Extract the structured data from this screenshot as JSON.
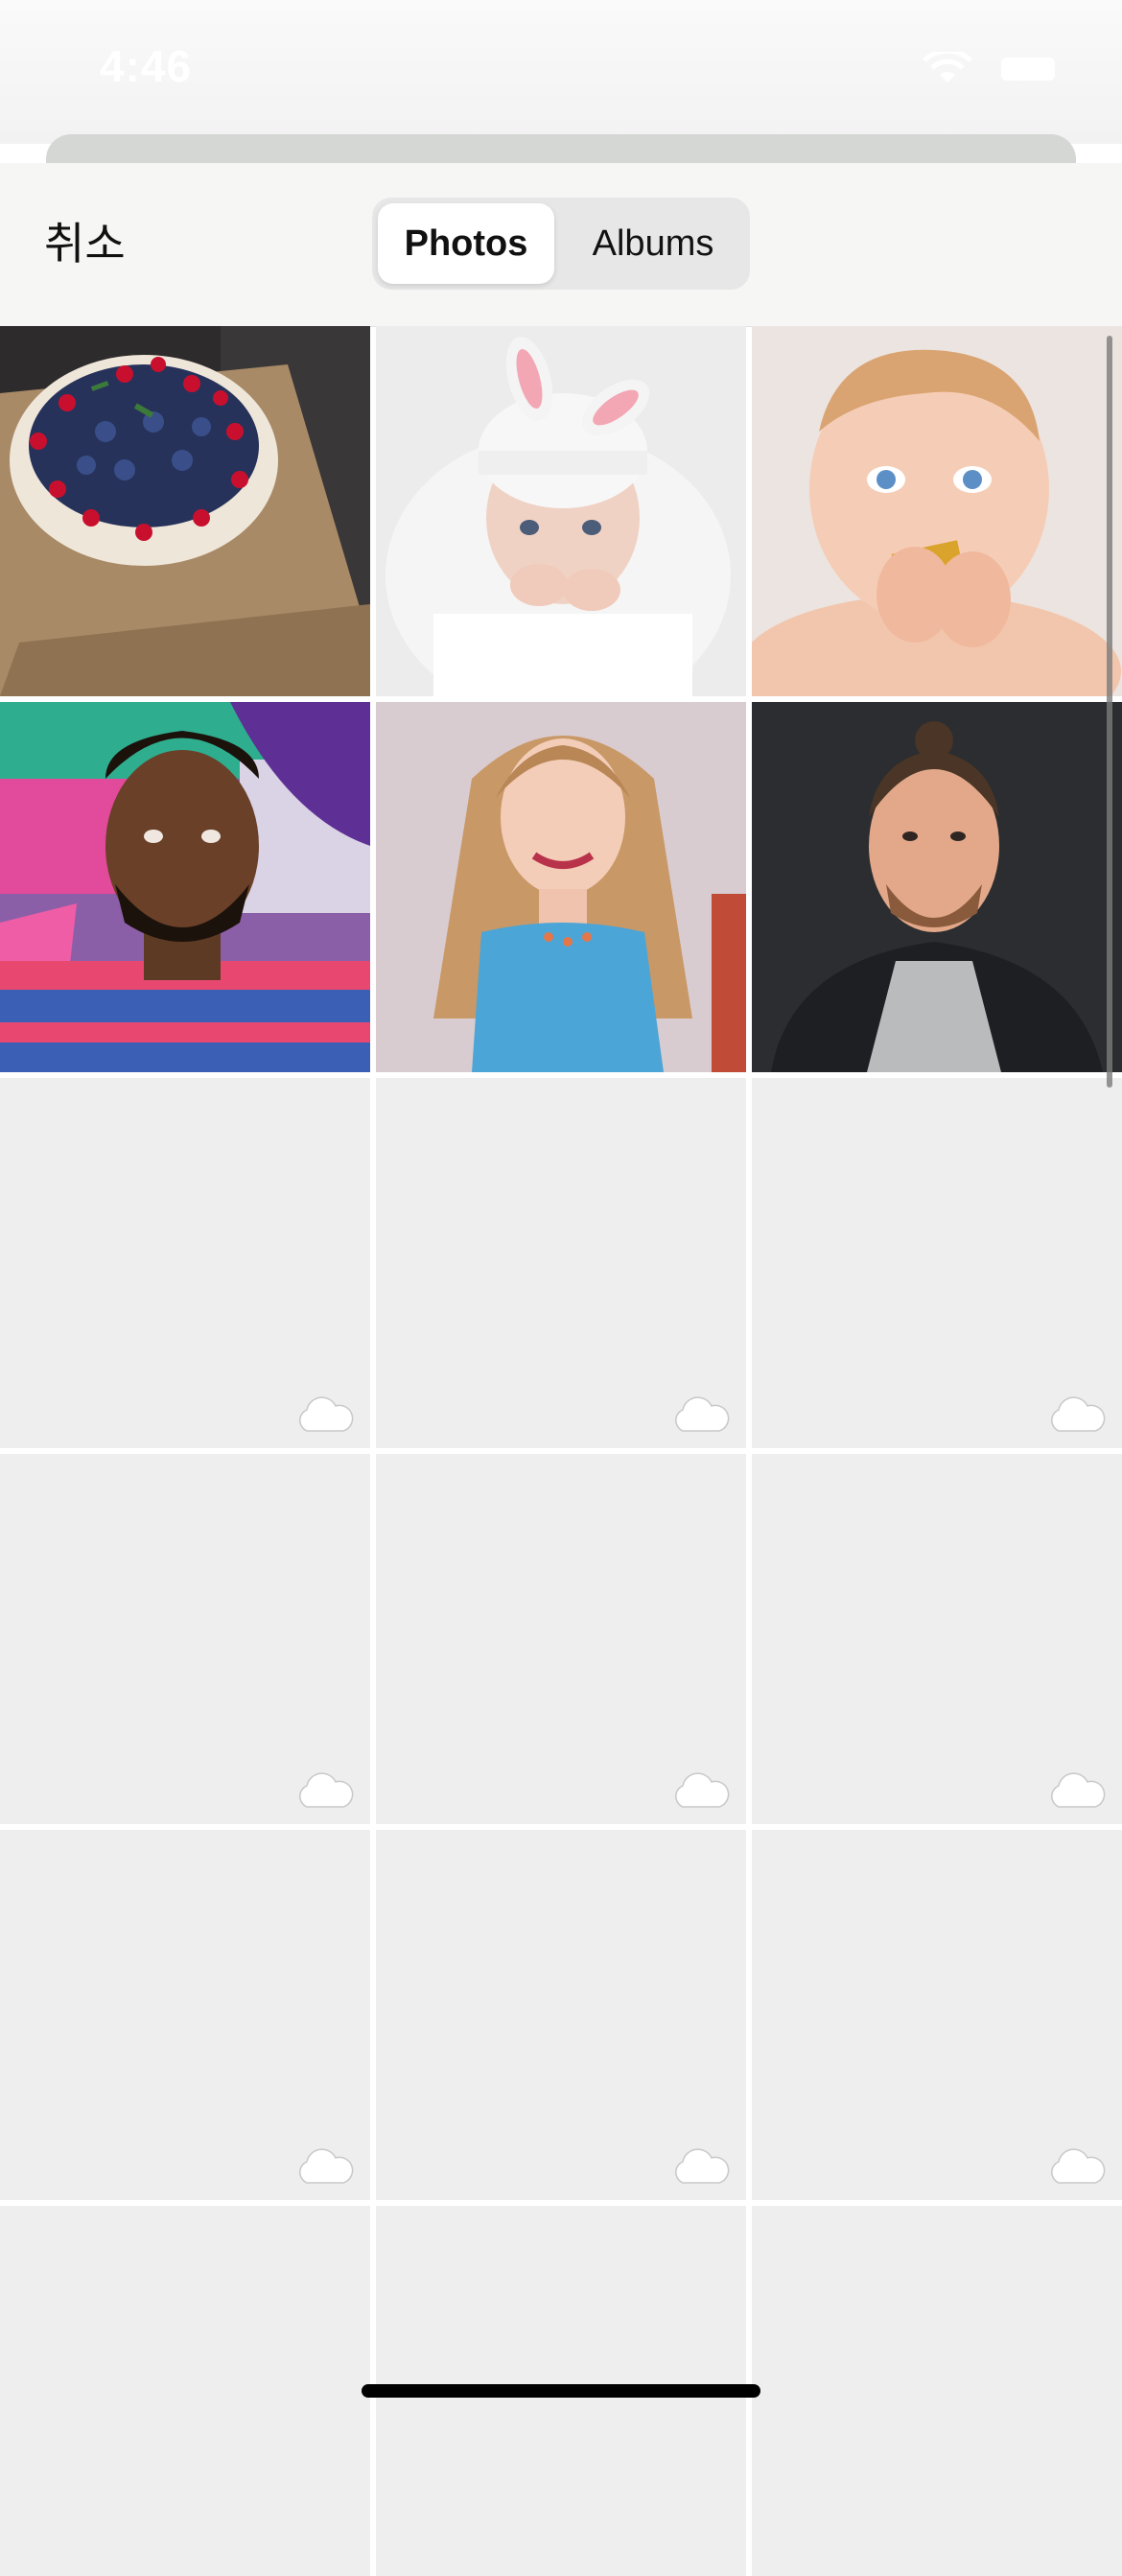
{
  "status_bar": {
    "time": "4:46",
    "icons": [
      "wifi-icon",
      "battery-icon"
    ]
  },
  "nav": {
    "cancel_label": "취소",
    "segments": [
      "Photos",
      "Albums"
    ],
    "selected_segment": "Photos"
  },
  "grid": {
    "columns": 3,
    "photos": [
      {
        "name": "photo-berry-pavlova",
        "subject": "berry pavlova cake"
      },
      {
        "name": "photo-baby-bunny-hat",
        "subject": "baby in bunny hat"
      },
      {
        "name": "photo-baby-block",
        "subject": "baby chewing block"
      },
      {
        "name": "photo-man-graffiti",
        "subject": "man with graffiti background"
      },
      {
        "name": "photo-woman-smiling",
        "subject": "smiling woman"
      },
      {
        "name": "photo-man-dark-background",
        "subject": "man on dark background"
      }
    ],
    "placeholder_icon": "cloud-icon",
    "placeholder_count": 12
  },
  "colors": {
    "nav_background": "#f6f6f5",
    "placeholder_background": "#eeeeee",
    "segment_background": "#e7e7e7"
  }
}
